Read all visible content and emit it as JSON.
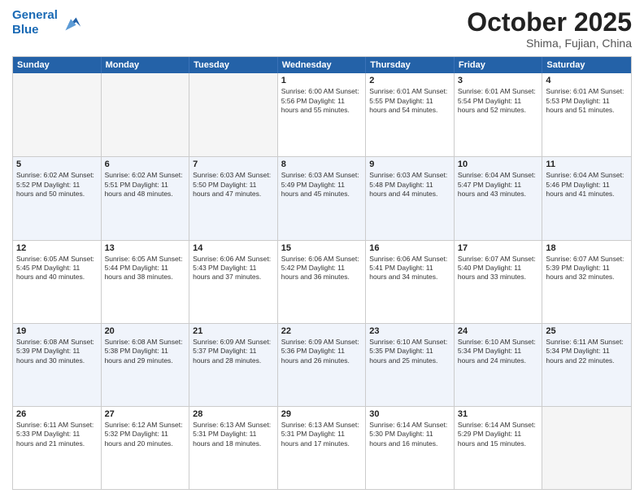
{
  "header": {
    "logo_line1": "General",
    "logo_line2": "Blue",
    "month_title": "October 2025",
    "subtitle": "Shima, Fujian, China"
  },
  "days_of_week": [
    "Sunday",
    "Monday",
    "Tuesday",
    "Wednesday",
    "Thursday",
    "Friday",
    "Saturday"
  ],
  "weeks": [
    [
      {
        "day": "",
        "empty": true,
        "info": ""
      },
      {
        "day": "",
        "empty": true,
        "info": ""
      },
      {
        "day": "",
        "empty": true,
        "info": ""
      },
      {
        "day": "1",
        "info": "Sunrise: 6:00 AM\nSunset: 5:56 PM\nDaylight: 11 hours\nand 55 minutes."
      },
      {
        "day": "2",
        "info": "Sunrise: 6:01 AM\nSunset: 5:55 PM\nDaylight: 11 hours\nand 54 minutes."
      },
      {
        "day": "3",
        "info": "Sunrise: 6:01 AM\nSunset: 5:54 PM\nDaylight: 11 hours\nand 52 minutes."
      },
      {
        "day": "4",
        "info": "Sunrise: 6:01 AM\nSunset: 5:53 PM\nDaylight: 11 hours\nand 51 minutes."
      }
    ],
    [
      {
        "day": "5",
        "info": "Sunrise: 6:02 AM\nSunset: 5:52 PM\nDaylight: 11 hours\nand 50 minutes."
      },
      {
        "day": "6",
        "info": "Sunrise: 6:02 AM\nSunset: 5:51 PM\nDaylight: 11 hours\nand 48 minutes."
      },
      {
        "day": "7",
        "info": "Sunrise: 6:03 AM\nSunset: 5:50 PM\nDaylight: 11 hours\nand 47 minutes."
      },
      {
        "day": "8",
        "info": "Sunrise: 6:03 AM\nSunset: 5:49 PM\nDaylight: 11 hours\nand 45 minutes."
      },
      {
        "day": "9",
        "info": "Sunrise: 6:03 AM\nSunset: 5:48 PM\nDaylight: 11 hours\nand 44 minutes."
      },
      {
        "day": "10",
        "info": "Sunrise: 6:04 AM\nSunset: 5:47 PM\nDaylight: 11 hours\nand 43 minutes."
      },
      {
        "day": "11",
        "info": "Sunrise: 6:04 AM\nSunset: 5:46 PM\nDaylight: 11 hours\nand 41 minutes."
      }
    ],
    [
      {
        "day": "12",
        "info": "Sunrise: 6:05 AM\nSunset: 5:45 PM\nDaylight: 11 hours\nand 40 minutes."
      },
      {
        "day": "13",
        "info": "Sunrise: 6:05 AM\nSunset: 5:44 PM\nDaylight: 11 hours\nand 38 minutes."
      },
      {
        "day": "14",
        "info": "Sunrise: 6:06 AM\nSunset: 5:43 PM\nDaylight: 11 hours\nand 37 minutes."
      },
      {
        "day": "15",
        "info": "Sunrise: 6:06 AM\nSunset: 5:42 PM\nDaylight: 11 hours\nand 36 minutes."
      },
      {
        "day": "16",
        "info": "Sunrise: 6:06 AM\nSunset: 5:41 PM\nDaylight: 11 hours\nand 34 minutes."
      },
      {
        "day": "17",
        "info": "Sunrise: 6:07 AM\nSunset: 5:40 PM\nDaylight: 11 hours\nand 33 minutes."
      },
      {
        "day": "18",
        "info": "Sunrise: 6:07 AM\nSunset: 5:39 PM\nDaylight: 11 hours\nand 32 minutes."
      }
    ],
    [
      {
        "day": "19",
        "info": "Sunrise: 6:08 AM\nSunset: 5:39 PM\nDaylight: 11 hours\nand 30 minutes."
      },
      {
        "day": "20",
        "info": "Sunrise: 6:08 AM\nSunset: 5:38 PM\nDaylight: 11 hours\nand 29 minutes."
      },
      {
        "day": "21",
        "info": "Sunrise: 6:09 AM\nSunset: 5:37 PM\nDaylight: 11 hours\nand 28 minutes."
      },
      {
        "day": "22",
        "info": "Sunrise: 6:09 AM\nSunset: 5:36 PM\nDaylight: 11 hours\nand 26 minutes."
      },
      {
        "day": "23",
        "info": "Sunrise: 6:10 AM\nSunset: 5:35 PM\nDaylight: 11 hours\nand 25 minutes."
      },
      {
        "day": "24",
        "info": "Sunrise: 6:10 AM\nSunset: 5:34 PM\nDaylight: 11 hours\nand 24 minutes."
      },
      {
        "day": "25",
        "info": "Sunrise: 6:11 AM\nSunset: 5:34 PM\nDaylight: 11 hours\nand 22 minutes."
      }
    ],
    [
      {
        "day": "26",
        "info": "Sunrise: 6:11 AM\nSunset: 5:33 PM\nDaylight: 11 hours\nand 21 minutes."
      },
      {
        "day": "27",
        "info": "Sunrise: 6:12 AM\nSunset: 5:32 PM\nDaylight: 11 hours\nand 20 minutes."
      },
      {
        "day": "28",
        "info": "Sunrise: 6:13 AM\nSunset: 5:31 PM\nDaylight: 11 hours\nand 18 minutes."
      },
      {
        "day": "29",
        "info": "Sunrise: 6:13 AM\nSunset: 5:31 PM\nDaylight: 11 hours\nand 17 minutes."
      },
      {
        "day": "30",
        "info": "Sunrise: 6:14 AM\nSunset: 5:30 PM\nDaylight: 11 hours\nand 16 minutes."
      },
      {
        "day": "31",
        "info": "Sunrise: 6:14 AM\nSunset: 5:29 PM\nDaylight: 11 hours\nand 15 minutes."
      },
      {
        "day": "",
        "empty": true,
        "info": ""
      }
    ]
  ]
}
